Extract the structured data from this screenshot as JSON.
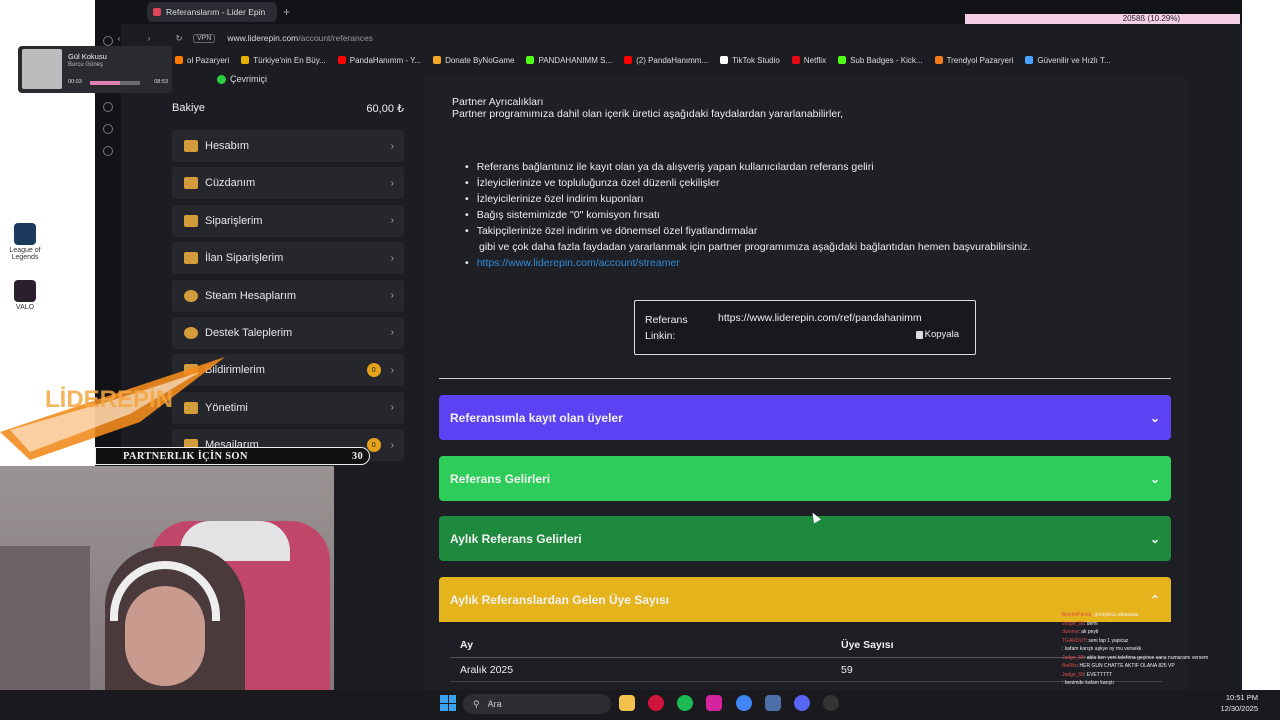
{
  "browser": {
    "tab_title": "Referanslarım - Lider Epin",
    "vpn": "VPN",
    "url_host": "www.liderepin.com",
    "url_path": "/account/referances",
    "bookmarks": [
      {
        "label": "ol Pazaryeri",
        "color": "#ff7a00"
      },
      {
        "label": "Türkiye'nin En Büy...",
        "color": "#e8b100"
      },
      {
        "label": "PandaHanımm - Y...",
        "color": "#ff0000"
      },
      {
        "label": "Donate ByNoGame",
        "color": "#f5a623"
      },
      {
        "label": "PANDAHANIMM S...",
        "color": "#53fc18"
      },
      {
        "label": "(2) PandaHanımm...",
        "color": "#ff0000"
      },
      {
        "label": "TikTok Studio",
        "color": "#ffffff"
      },
      {
        "label": "Netflix",
        "color": "#e50914"
      },
      {
        "label": "Sub Badges - Kick...",
        "color": "#53fc18"
      },
      {
        "label": "Trendyol Pazaryeri",
        "color": "#f27a1a"
      },
      {
        "label": "Güvenilir ve Hızlı T...",
        "color": "#4aa3ff"
      }
    ]
  },
  "sidebar": {
    "status": "Çevrimiçi",
    "balance_label": "Bakiye",
    "balance_value": "60,00 ₺",
    "items": [
      {
        "label": "Hesabım",
        "icon": "user-icon"
      },
      {
        "label": "Cüzdanım",
        "icon": "wallet-icon"
      },
      {
        "label": "Siparişlerim",
        "icon": "cart-icon"
      },
      {
        "label": "İlan Siparişlerim",
        "icon": "bag-icon"
      },
      {
        "label": "Steam Hesaplarım",
        "icon": "steam-icon"
      },
      {
        "label": "Destek Taleplerim",
        "icon": "headset-icon"
      },
      {
        "label": "Bildirimlerim",
        "icon": "bell-icon",
        "badge": "0"
      },
      {
        "label": "Yönetimi",
        "icon": "gear-icon"
      },
      {
        "label": "Mesajlarım",
        "icon": "mail-icon",
        "badge": "0"
      }
    ]
  },
  "partner": {
    "title": "Partner Ayrıcalıkları",
    "intro": "Partner programımıza dahil olan içerik üretici aşağıdaki faydalardan yararlanabilirler,",
    "benefits": [
      "Referans bağlantınız ile kayıt olan ya da alışveriş yapan kullanıcılardan referans geliri",
      "İzleyicilerinize ve topluluğunza özel düzenli çekilişler",
      "İzleyicilerinize özel indirim kuponları",
      "Bağış sistemimizde \"0\" komisyon fırsatı",
      "Takipçilerinize özel indirim ve dönemsel özel fiyatlandırmalar"
    ],
    "closing": "gibi ve çok daha fazla faydadan yararlanmak için partner programımıza aşağıdaki bağlantıdan hemen başvurabilirsiniz.",
    "link": "https://www.liderepin.com/account/streamer"
  },
  "referral": {
    "label": "Referans Linkin:",
    "url": "https://www.liderepin.com/ref/pandahanimm",
    "copy": "Kopyala"
  },
  "accordions": [
    {
      "label": "Referansımla kayıt olan üyeler",
      "expanded": false,
      "color": "#5b42f3"
    },
    {
      "label": "Referans Gelirleri",
      "expanded": false,
      "color": "#2ecd5a"
    },
    {
      "label": "Aylık Referans Gelirleri",
      "expanded": false,
      "color": "#1e8a3e"
    },
    {
      "label": "Aylık Referanslardan Gelen Üye Sayısı",
      "expanded": true,
      "color": "#e5b31c"
    }
  ],
  "table": {
    "headers": [
      "Ay",
      "Üye Sayısı"
    ],
    "rows": [
      [
        "Aralık 2025",
        "59"
      ]
    ]
  },
  "overlays": {
    "music_title": "Gül Kokusu",
    "music_artist": "Burcu Güneş",
    "music_elapsed": "00:03",
    "music_total": "08:53",
    "music_progress": 0.6,
    "bitrate": "2058ß (10.29%)",
    "banner_text": "PARTNERLIK İÇİN SON",
    "banner_count": "30",
    "logo_text": "LİDEREPİN",
    "chat": [
      {
        "user": "BlokirkPanda",
        "text": ": görüşürüz ablaaaaa"
      },
      {
        "user": "Judge_58",
        "text": ": demi"
      },
      {
        "user": "dummy",
        "text": ": ak peyti"
      },
      {
        "user": "TGARDUT",
        "text": ": seni tap 1 yapicaz"
      },
      {
        "user": "",
        "text": ": kafam karıştı aşkye oy mu versekk"
      },
      {
        "user": "Judge_58",
        "text": ": abla ben yeni telefona geçince sana numaramı versem"
      },
      {
        "user": "BotRix",
        "text": ": HER GÜN CHATTE AKTİF OLANA 825 VP"
      },
      {
        "user": "Judge_58",
        "text": ": EVETTTTT"
      },
      {
        "user": "",
        "text": ": benimde kafam karıştı"
      }
    ]
  },
  "desktop_icons": [
    {
      "label": "League of Legends"
    },
    {
      "label": "VALO"
    }
  ],
  "taskbar": {
    "search": "Ara",
    "time": "10:51 PM",
    "date": "12/30/2025"
  }
}
